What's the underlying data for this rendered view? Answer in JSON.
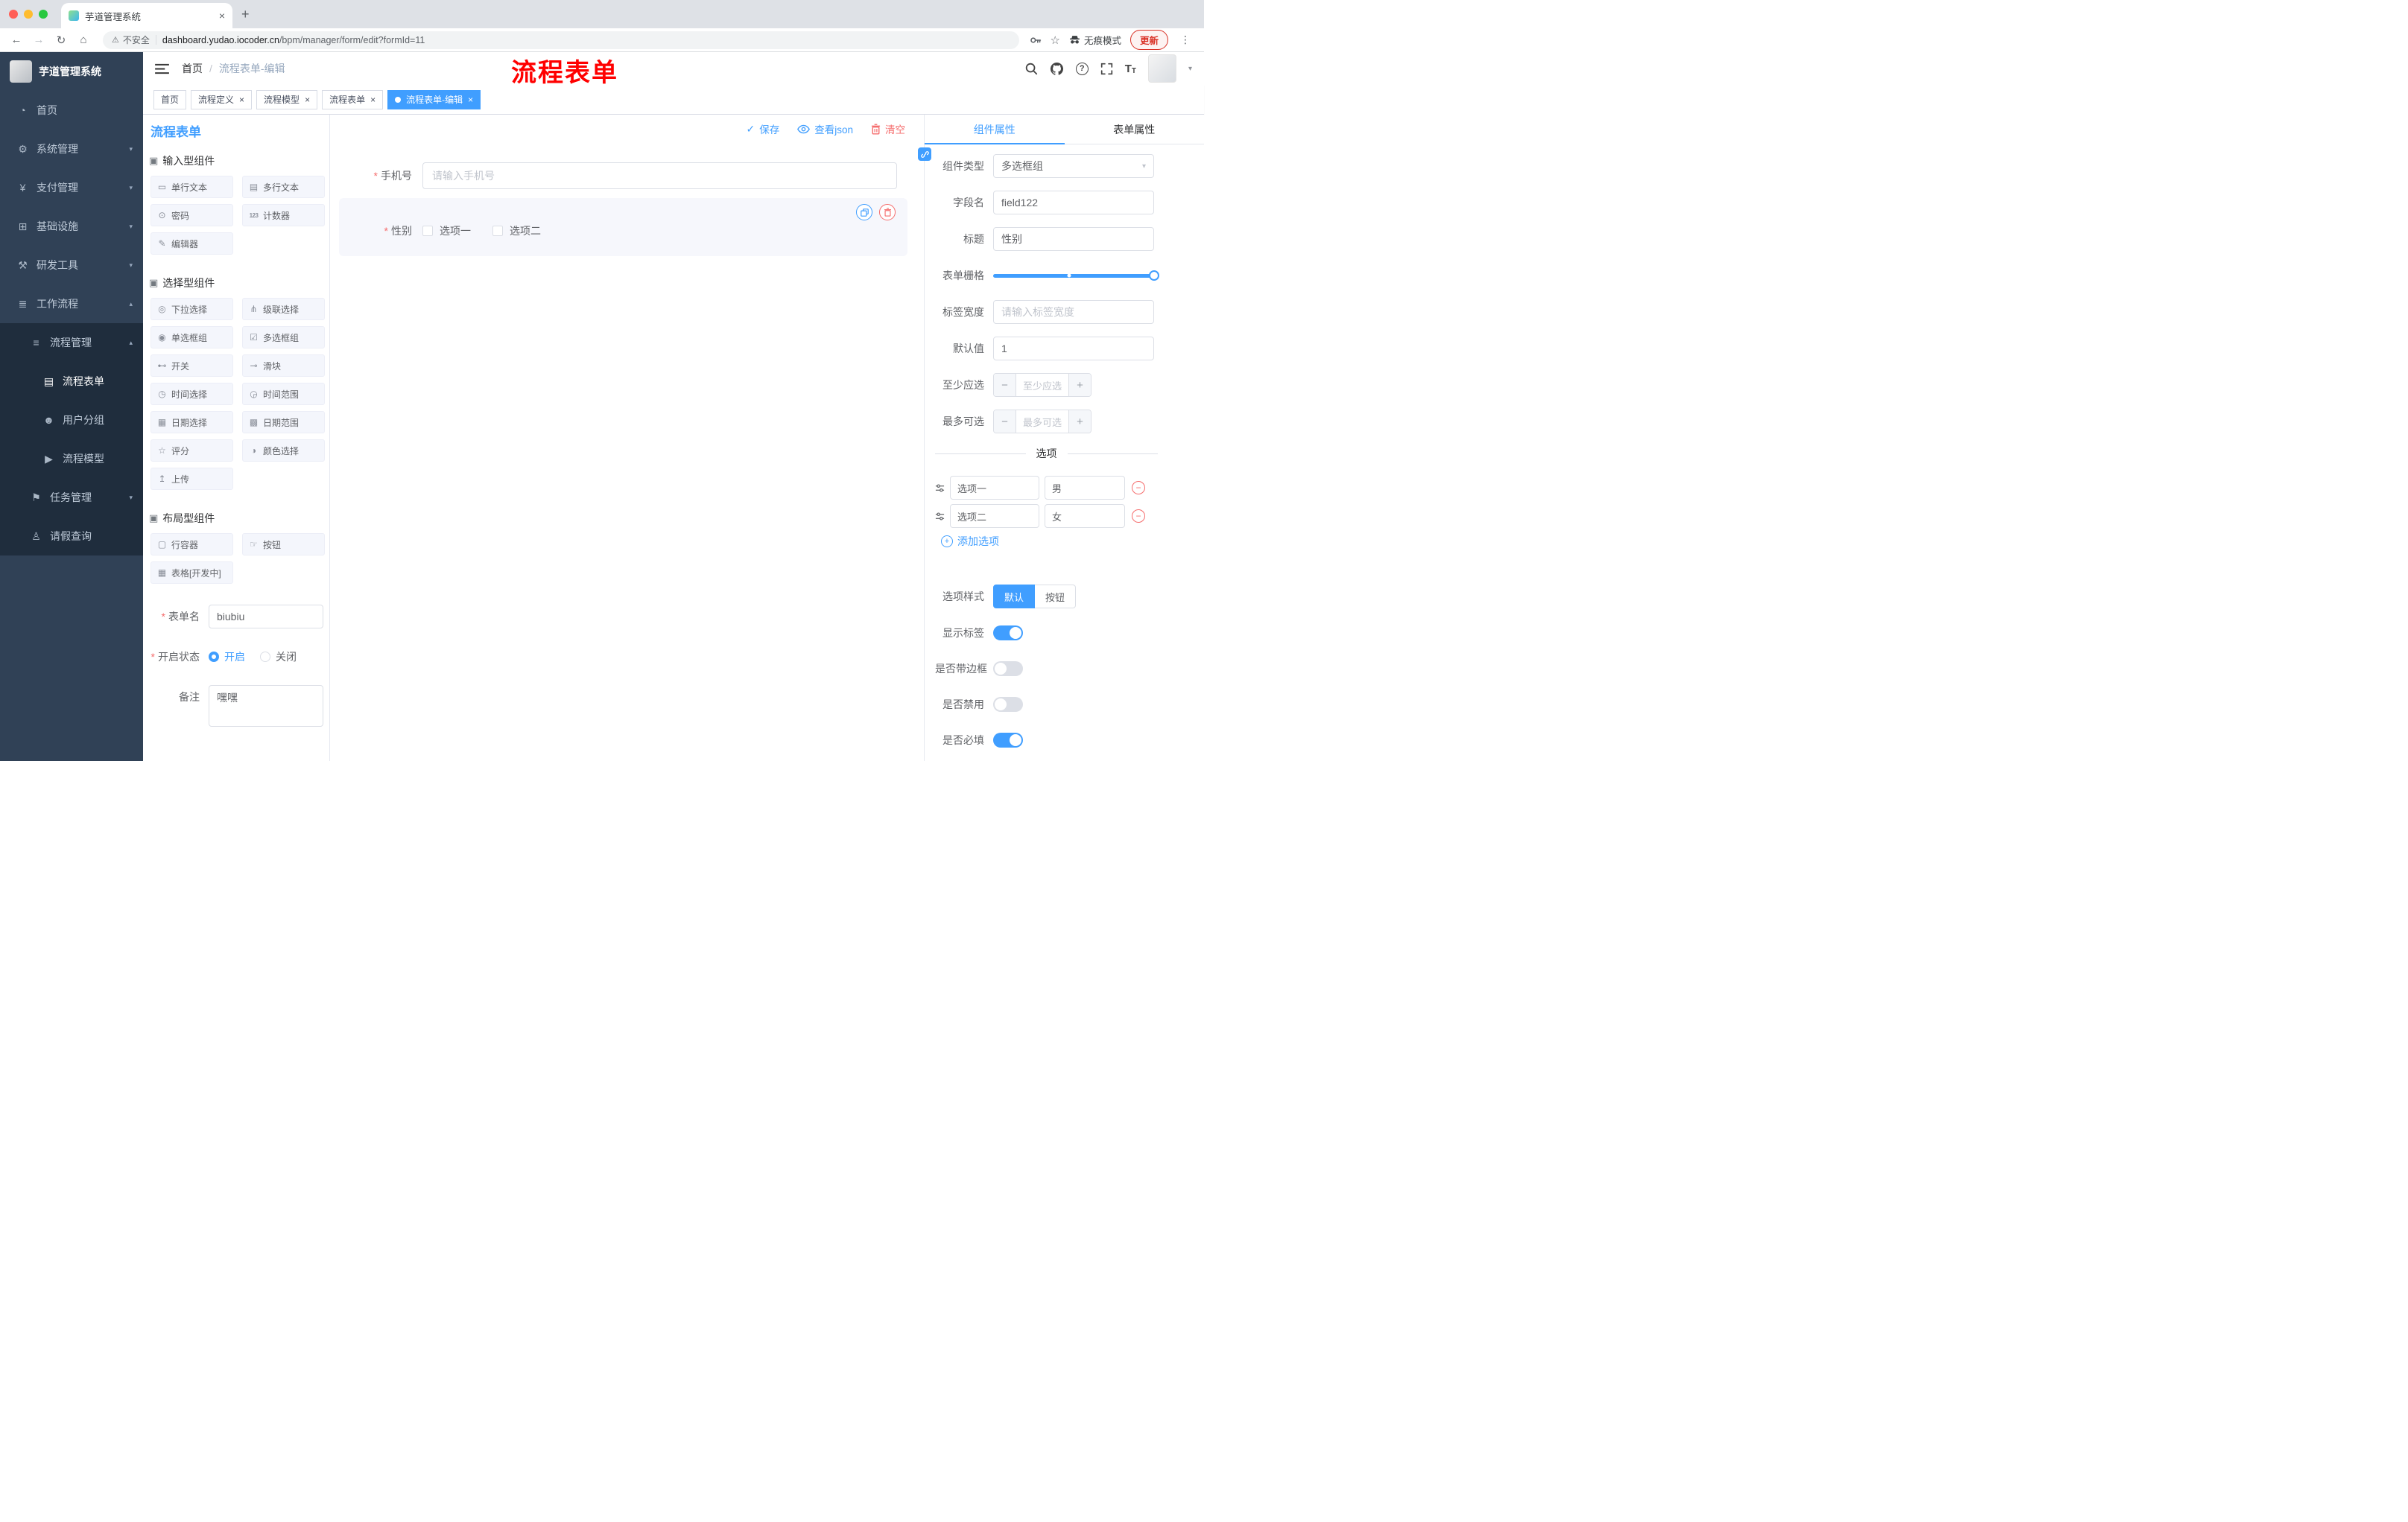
{
  "icons": {
    "close": "×",
    "plus": "+",
    "back": "←",
    "forward": "→",
    "reload": "↻",
    "home": "⌂",
    "warning": "⚠",
    "star": "☆",
    "ellipsis": "⋮",
    "slash": "/",
    "caret_down": "▾",
    "caret_up": "▴",
    "check": "✓",
    "question": "?",
    "font_big": "T",
    "font_small": "T",
    "minus": "−"
  },
  "browser": {
    "tab_title": "芋道管理系统",
    "security_label": "不安全",
    "url_host": "dashboard.yudao.iocoder.cn",
    "url_path": "/bpm/manager/form/edit?formId=11",
    "incognito_label": "无痕模式",
    "update_label": "更新"
  },
  "sidebar": {
    "logo_text": "芋道管理系统",
    "menu": [
      {
        "label": "首页",
        "icon": "◔"
      },
      {
        "label": "系统管理",
        "icon": "⚙"
      },
      {
        "label": "支付管理",
        "icon": "¥"
      },
      {
        "label": "基础设施",
        "icon": "⊞"
      },
      {
        "label": "研发工具",
        "icon": "⚒"
      },
      {
        "label": "工作流程",
        "icon": "≣"
      },
      {
        "label": "流程管理",
        "icon": "≡"
      },
      {
        "label": "流程表单",
        "icon": "▤",
        "active": true
      },
      {
        "label": "用户分组",
        "icon": "☻"
      },
      {
        "label": "流程模型",
        "icon": "▶"
      },
      {
        "label": "任务管理",
        "icon": "⚑"
      },
      {
        "label": "请假查询",
        "icon": "♙"
      }
    ]
  },
  "header": {
    "breadcrumb": [
      "首页",
      "流程表单-编辑"
    ],
    "annotation": "流程表单"
  },
  "tags": [
    {
      "label": "首页",
      "closable": false,
      "active": false
    },
    {
      "label": "流程定义",
      "closable": true,
      "active": false
    },
    {
      "label": "流程模型",
      "closable": true,
      "active": false
    },
    {
      "label": "流程表单",
      "closable": true,
      "active": false
    },
    {
      "label": "流程表单-编辑",
      "closable": true,
      "active": true
    }
  ],
  "palette": {
    "title": "流程表单",
    "sections": [
      {
        "icon": "▣",
        "title": "输入型组件",
        "items": [
          {
            "icon": "▭",
            "label": "单行文本"
          },
          {
            "icon": "▤",
            "label": "多行文本"
          },
          {
            "icon": "⊙",
            "label": "密码"
          },
          {
            "icon": "123",
            "label": "计数器"
          },
          {
            "icon": "✎",
            "label": "编辑器"
          }
        ]
      },
      {
        "icon": "▣",
        "title": "选择型组件",
        "items": [
          {
            "icon": "◎",
            "label": "下拉选择"
          },
          {
            "icon": "⋔",
            "label": "级联选择"
          },
          {
            "icon": "◉",
            "label": "单选框组"
          },
          {
            "icon": "☑",
            "label": "多选框组"
          },
          {
            "icon": "⊷",
            "label": "开关"
          },
          {
            "icon": "⊸",
            "label": "滑块"
          },
          {
            "icon": "◷",
            "label": "时间选择"
          },
          {
            "icon": "◶",
            "label": "时间范围"
          },
          {
            "icon": "▦",
            "label": "日期选择"
          },
          {
            "icon": "▩",
            "label": "日期范围"
          },
          {
            "icon": "☆",
            "label": "评分"
          },
          {
            "icon": "◑",
            "label": "颜色选择"
          },
          {
            "icon": "↥",
            "label": "上传"
          }
        ]
      },
      {
        "icon": "▣",
        "title": "布局型组件",
        "items": [
          {
            "icon": "▢",
            "label": "行容器"
          },
          {
            "icon": "☞",
            "label": "按钮"
          },
          {
            "icon": "▦",
            "label": "表格[开发中]"
          }
        ]
      }
    ]
  },
  "form_config": {
    "name": {
      "label": "表单名",
      "value": "biubiu"
    },
    "status": {
      "label": "开启状态",
      "on": "开启",
      "off": "关闭",
      "selected": "开启"
    },
    "remark": {
      "label": "备注",
      "value": "嘿嘿"
    }
  },
  "canvas": {
    "save": "保存",
    "view_json": "查看json",
    "clear": "清空",
    "phone": {
      "label": "手机号",
      "placeholder": "请输入手机号"
    },
    "gender": {
      "label": "性别",
      "options": [
        "选项一",
        "选项二"
      ]
    }
  },
  "props": {
    "tabs": {
      "component": "组件属性",
      "form": "表单属性"
    },
    "type": {
      "label": "组件类型",
      "value": "多选框组"
    },
    "field": {
      "label": "字段名",
      "value": "field122"
    },
    "title": {
      "label": "标题",
      "value": "性别"
    },
    "grid": {
      "label": "表单栅格"
    },
    "label_width": {
      "label": "标签宽度",
      "placeholder": "请输入标签宽度"
    },
    "default": {
      "label": "默认值",
      "value": "1"
    },
    "min": {
      "label": "至少应选",
      "placeholder": "至少应选"
    },
    "max": {
      "label": "最多可选",
      "placeholder": "最多可选"
    },
    "divider": "选项",
    "options": [
      {
        "label": "选项一",
        "value": "男"
      },
      {
        "label": "选项二",
        "value": "女"
      }
    ],
    "add_option": "添加选项",
    "style": {
      "label": "选项样式",
      "default": "默认",
      "button": "按钮",
      "selected": "默认"
    },
    "switches": [
      {
        "label": "显示标签",
        "on": true
      },
      {
        "label": "是否带边框",
        "on": false
      },
      {
        "label": "是否禁用",
        "on": false
      },
      {
        "label": "是否必填",
        "on": true
      }
    ]
  }
}
